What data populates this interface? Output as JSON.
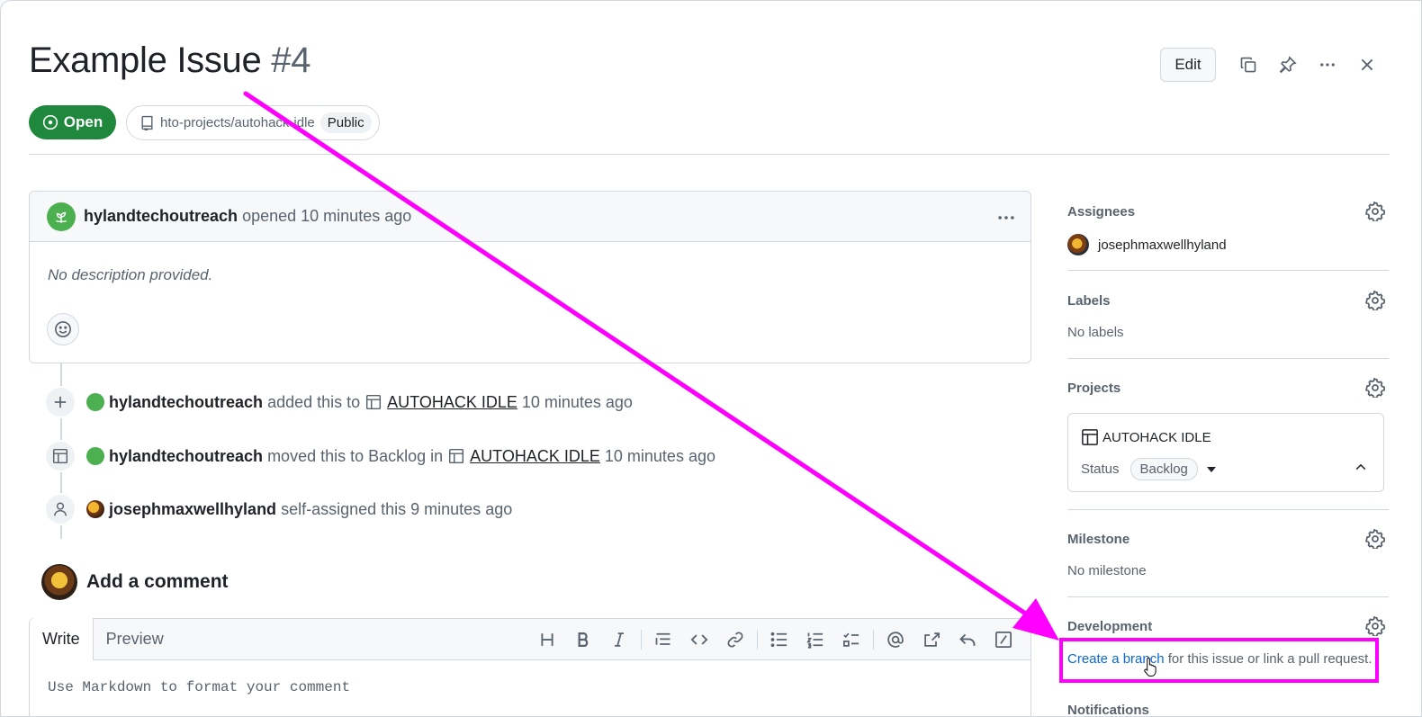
{
  "issue": {
    "title": "Example Issue",
    "number": "#4",
    "state": "Open",
    "repo": "hto-projects/autohack-idle",
    "visibility": "Public"
  },
  "header_actions": {
    "edit_label": "Edit",
    "copy_icon": "copy-icon",
    "pin_icon": "pin-icon",
    "more_icon": "kebab-horizontal-icon",
    "close_icon": "close-icon"
  },
  "comment": {
    "author": "hylandtechoutreach",
    "action": "opened",
    "time": "10 minutes ago",
    "body": "No description provided."
  },
  "timeline": [
    {
      "icon": "plus-icon",
      "user": "hylandtechoutreach",
      "text1": "added this to",
      "project": "AUTOHACK IDLE",
      "text2": "",
      "time": "10 minutes ago"
    },
    {
      "icon": "table-icon",
      "user": "hylandtechoutreach",
      "text1": "moved this to Backlog in",
      "project": "AUTOHACK IDLE",
      "text2": "",
      "time": "10 minutes ago"
    },
    {
      "icon": "person-icon",
      "user": "josephmaxwellhyland",
      "text1": "self-assigned this 9 minutes ago",
      "project": "",
      "text2": "",
      "time": ""
    }
  ],
  "add_comment": {
    "title": "Add a comment",
    "tab_write": "Write",
    "tab_preview": "Preview",
    "placeholder": "Use Markdown to format your comment"
  },
  "sidebar": {
    "assignees": {
      "label": "Assignees",
      "value": "josephmaxwellhyland"
    },
    "labels": {
      "label": "Labels",
      "value": "No labels"
    },
    "projects": {
      "label": "Projects",
      "name": "AUTOHACK IDLE",
      "status_label": "Status",
      "status": "Backlog"
    },
    "milestone": {
      "label": "Milestone",
      "value": "No milestone"
    },
    "development": {
      "label": "Development",
      "link": "Create a branch",
      "rest": " for this issue or link a pull request."
    },
    "notifications": {
      "label": "Notifications"
    }
  },
  "colors": {
    "open_green": "#1f883d",
    "link_blue": "#0969da",
    "annotation_magenta": "#ff00ff"
  }
}
